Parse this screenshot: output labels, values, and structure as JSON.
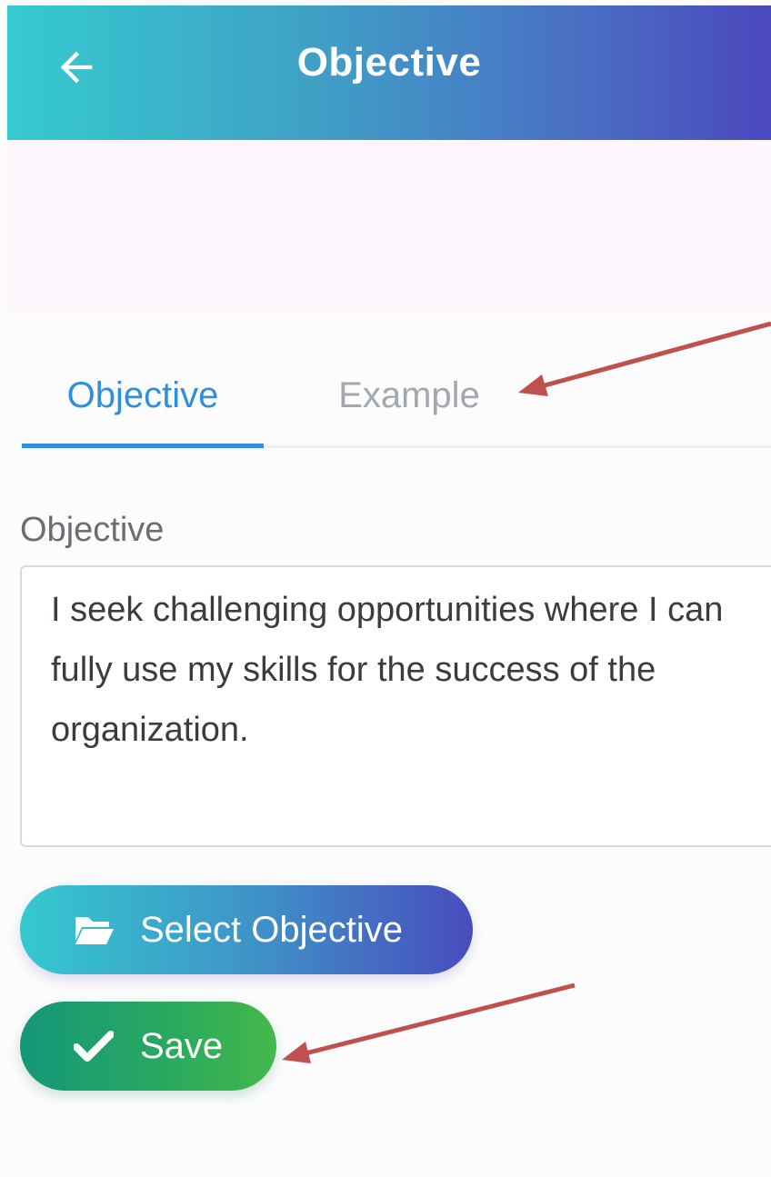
{
  "appbar": {
    "title": "Objective",
    "back_icon": "arrow-left-icon"
  },
  "tabs": [
    {
      "label": "Objective",
      "active": true
    },
    {
      "label": "Example",
      "active": false
    }
  ],
  "objective_field": {
    "label": "Objective",
    "value": "I seek challenging opportunities where I can fully use my skills for the success of the organization."
  },
  "buttons": {
    "select_objective": {
      "label": "Select Objective",
      "icon": "folder-open-icon"
    },
    "save": {
      "label": "Save",
      "icon": "check-icon"
    }
  },
  "colors": {
    "header_gradient_start": "#35cbcf",
    "header_gradient_end": "#4a48bd",
    "tab_active": "#2f8fde",
    "tab_inactive": "#a2a8ae",
    "save_gradient_start": "#14977a",
    "save_gradient_end": "#46b84a",
    "annotation_arrow": "#c0504d"
  }
}
